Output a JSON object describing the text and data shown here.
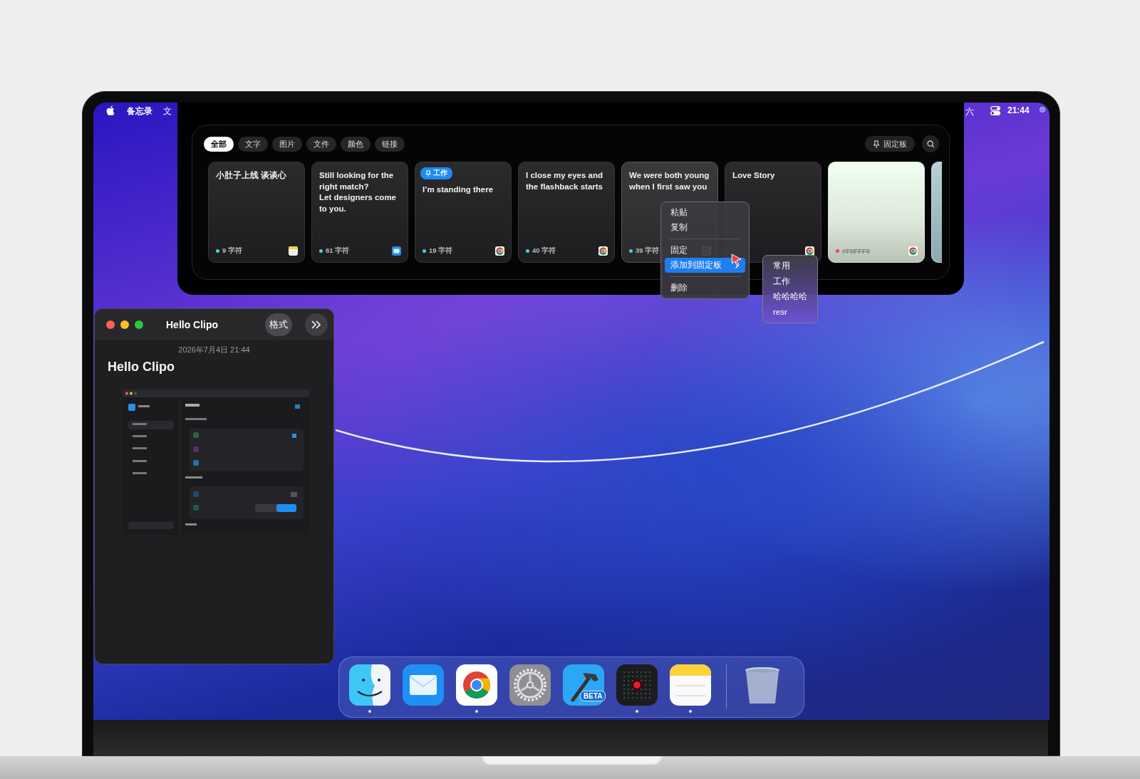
{
  "menu_bar": {
    "app_name": "备忘录",
    "items": [
      "文"
    ],
    "day": "六",
    "time": "21:44"
  },
  "clipboard_panel": {
    "filters": [
      {
        "label": "全部",
        "selected": true
      },
      {
        "label": "文字",
        "selected": false
      },
      {
        "label": "图片",
        "selected": false
      },
      {
        "label": "文件",
        "selected": false
      },
      {
        "label": "颜色",
        "selected": false
      },
      {
        "label": "链接",
        "selected": false
      }
    ],
    "pinboard_button": "固定板",
    "cards": [
      {
        "kind": "text",
        "text": "小肚子上线 谈谈心",
        "count": "9 字符",
        "source": {
          "kind": "notes"
        },
        "color": "#3fd3e6",
        "selected": false
      },
      {
        "kind": "text",
        "text": "Still looking for the right match?\nLet designers come to you.",
        "count": "61 字符",
        "source": {
          "kind": "mail"
        },
        "color": "#3fd3e6",
        "selected": false
      },
      {
        "kind": "text",
        "tag": "工作",
        "text": "I’m standing there",
        "count": "19 字符",
        "source": {
          "kind": "chrome"
        },
        "color": "#3fd3e6",
        "selected": false
      },
      {
        "kind": "text",
        "text": "I close my eyes and the flashback starts",
        "count": "40 字符",
        "source": {
          "kind": "chrome"
        },
        "color": "#3fd3e6",
        "selected": false
      },
      {
        "kind": "text",
        "text": "We were both young when I first saw you",
        "count": "39 字符",
        "source": {
          "kind": "chrome"
        },
        "color": "#3fd3e6",
        "selected": true
      },
      {
        "kind": "text",
        "text": "Love Story",
        "source": {
          "kind": "chrome"
        },
        "selected": false
      },
      {
        "kind": "color",
        "text": "#F0FFF0",
        "source": {
          "kind": "chrome"
        },
        "color": "#ff3b6b",
        "selected": false
      },
      {
        "kind": "partial"
      }
    ]
  },
  "context_menu": {
    "items": [
      {
        "kind": "item",
        "label": "粘贴",
        "selected": false
      },
      {
        "kind": "item",
        "label": "复制",
        "selected": false
      },
      {
        "kind": "separator"
      },
      {
        "kind": "item",
        "label": "固定",
        "selected": false
      },
      {
        "kind": "submenu",
        "label": "添加到固定板",
        "selected": true
      },
      {
        "kind": "separator"
      },
      {
        "kind": "item",
        "label": "删除",
        "selected": false
      }
    ],
    "submenu": [
      "常用",
      "工作",
      "哈哈哈哈",
      "resr"
    ]
  },
  "notes_window": {
    "title": "Hello Clipo",
    "format_button": "格式",
    "date": "2026年7月4日 21:44",
    "heading": "Hello Clipo"
  },
  "dock": {
    "items": [
      {
        "kind": "finder",
        "running": true
      },
      {
        "kind": "mail",
        "running": false
      },
      {
        "kind": "chrome",
        "running": true
      },
      {
        "kind": "settings",
        "running": false
      },
      {
        "kind": "xcode",
        "badge": "BETA",
        "running": false
      },
      {
        "kind": "recorder",
        "running": true
      },
      {
        "kind": "notes",
        "running": true
      },
      {
        "kind": "separator"
      },
      {
        "kind": "trash",
        "running": false
      }
    ]
  }
}
